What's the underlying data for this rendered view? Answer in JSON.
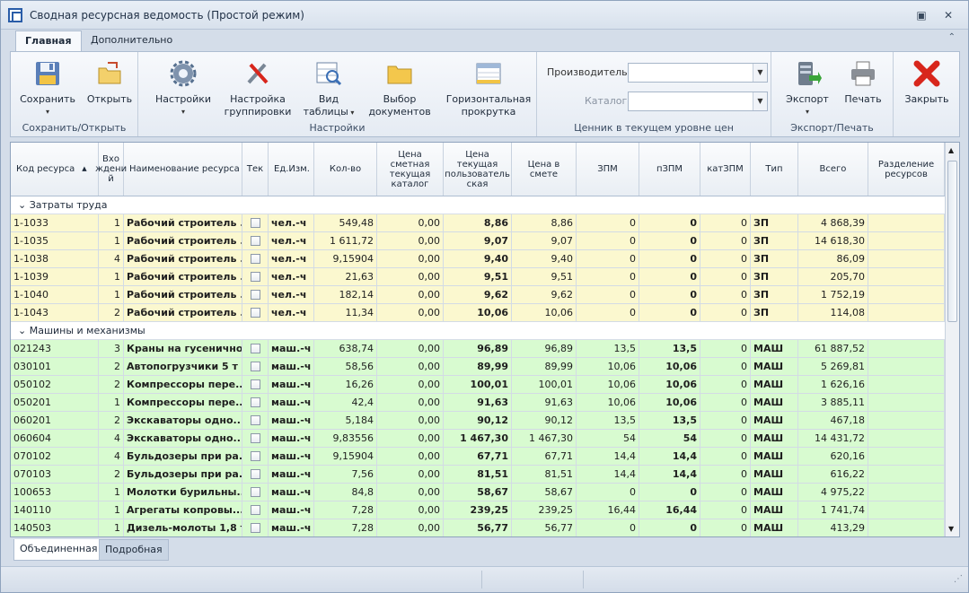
{
  "window": {
    "title": "Сводная ресурсная ведомость (Простой режим)"
  },
  "ribbon_tabs": [
    {
      "label": "Главная"
    },
    {
      "label": "Дополнительно"
    }
  ],
  "ribbon": {
    "save": "Сохранить",
    "open": "Открыть",
    "group_save": "Сохранить/Открыть",
    "settings": "Настройки",
    "grouping": "Настройка группировки",
    "view": "Вид таблицы",
    "docs": "Выбор документов",
    "hscroll": "Горизонтальная прокрутка",
    "group_settings": "Настройки",
    "manufacturer_label": "Производитель",
    "catalog_label": "Каталог",
    "manufacturer_value": "",
    "catalog_value": "",
    "group_price": "Ценник в текущем уровне цен",
    "export": "Экспорт",
    "print": "Печать",
    "group_export": "Экспорт/Печать",
    "close": "Закрыть"
  },
  "grid": {
    "columns": [
      "Код ресурса",
      "Вхождений",
      "Наименование ресурса",
      "Тек",
      "Ед.Изм.",
      "Кол-во",
      "Цена сметная текущая каталог",
      "Цена текущая пользовательская",
      "Цена в смете",
      "ЗПМ",
      "пЗПМ",
      "катЗПМ",
      "Тип",
      "Всего",
      "Разделение ресурсов"
    ],
    "column_display": [
      "Код ресурса",
      "Вхо ждени й",
      "Наименование ресурса",
      "Тек",
      "Ед.Изм.",
      "Кол-во",
      "Цена сметная текущая каталог",
      "Цена текущая пользователь ская",
      "Цена в смете",
      "ЗПМ",
      "пЗПМ",
      "катЗПМ",
      "Тип",
      "Всего",
      "Разделение ресурсов"
    ],
    "groups": [
      {
        "name": "Затраты труда",
        "kind": "zp",
        "rows": [
          {
            "code": "1-1033",
            "cnt": "1",
            "name": "Рабочий строитель ...",
            "unit": "чел.-ч",
            "qty": "549,48",
            "p1": "0,00",
            "p2": "8,86",
            "p3": "8,86",
            "z1": "0",
            "z2": "0",
            "z3": "0",
            "type": "ЗП",
            "total": "4 868,39"
          },
          {
            "code": "1-1035",
            "cnt": "1",
            "name": "Рабочий строитель ...",
            "unit": "чел.-ч",
            "qty": "1 611,72",
            "p1": "0,00",
            "p2": "9,07",
            "p3": "9,07",
            "z1": "0",
            "z2": "0",
            "z3": "0",
            "type": "ЗП",
            "total": "14 618,30"
          },
          {
            "code": "1-1038",
            "cnt": "4",
            "name": "Рабочий строитель ...",
            "unit": "чел.-ч",
            "qty": "9,15904",
            "p1": "0,00",
            "p2": "9,40",
            "p3": "9,40",
            "z1": "0",
            "z2": "0",
            "z3": "0",
            "type": "ЗП",
            "total": "86,09"
          },
          {
            "code": "1-1039",
            "cnt": "1",
            "name": "Рабочий строитель ...",
            "unit": "чел.-ч",
            "qty": "21,63",
            "p1": "0,00",
            "p2": "9,51",
            "p3": "9,51",
            "z1": "0",
            "z2": "0",
            "z3": "0",
            "type": "ЗП",
            "total": "205,70"
          },
          {
            "code": "1-1040",
            "cnt": "1",
            "name": "Рабочий строитель ...",
            "unit": "чел.-ч",
            "qty": "182,14",
            "p1": "0,00",
            "p2": "9,62",
            "p3": "9,62",
            "z1": "0",
            "z2": "0",
            "z3": "0",
            "type": "ЗП",
            "total": "1 752,19"
          },
          {
            "code": "1-1043",
            "cnt": "2",
            "name": "Рабочий строитель ...",
            "unit": "чел.-ч",
            "qty": "11,34",
            "p1": "0,00",
            "p2": "10,06",
            "p3": "10,06",
            "z1": "0",
            "z2": "0",
            "z3": "0",
            "type": "ЗП",
            "total": "114,08"
          }
        ]
      },
      {
        "name": "Машины и механизмы",
        "kind": "mash",
        "rows": [
          {
            "code": "021243",
            "cnt": "3",
            "name": "Краны на гусенично...",
            "unit": "маш.-ч",
            "qty": "638,74",
            "p1": "0,00",
            "p2": "96,89",
            "p3": "96,89",
            "z1": "13,5",
            "z2": "13,5",
            "z3": "0",
            "type": "МАШ",
            "total": "61 887,52"
          },
          {
            "code": "030101",
            "cnt": "2",
            "name": "Автопогрузчики 5 т",
            "unit": "маш.-ч",
            "qty": "58,56",
            "p1": "0,00",
            "p2": "89,99",
            "p3": "89,99",
            "z1": "10,06",
            "z2": "10,06",
            "z3": "0",
            "type": "МАШ",
            "total": "5 269,81"
          },
          {
            "code": "050102",
            "cnt": "2",
            "name": "Компрессоры пере...",
            "unit": "маш.-ч",
            "qty": "16,26",
            "p1": "0,00",
            "p2": "100,01",
            "p3": "100,01",
            "z1": "10,06",
            "z2": "10,06",
            "z3": "0",
            "type": "МАШ",
            "total": "1 626,16"
          },
          {
            "code": "050201",
            "cnt": "1",
            "name": "Компрессоры пере...",
            "unit": "маш.-ч",
            "qty": "42,4",
            "p1": "0,00",
            "p2": "91,63",
            "p3": "91,63",
            "z1": "10,06",
            "z2": "10,06",
            "z3": "0",
            "type": "МАШ",
            "total": "3 885,11"
          },
          {
            "code": "060201",
            "cnt": "2",
            "name": "Экскаваторы одно...",
            "unit": "маш.-ч",
            "qty": "5,184",
            "p1": "0,00",
            "p2": "90,12",
            "p3": "90,12",
            "z1": "13,5",
            "z2": "13,5",
            "z3": "0",
            "type": "МАШ",
            "total": "467,18"
          },
          {
            "code": "060604",
            "cnt": "4",
            "name": "Экскаваторы одно...",
            "unit": "маш.-ч",
            "qty": "9,83556",
            "p1": "0,00",
            "p2": "1 467,30",
            "p3": "1 467,30",
            "z1": "54",
            "z2": "54",
            "z3": "0",
            "type": "МАШ",
            "total": "14 431,72"
          },
          {
            "code": "070102",
            "cnt": "4",
            "name": "Бульдозеры при ра...",
            "unit": "маш.-ч",
            "qty": "9,15904",
            "p1": "0,00",
            "p2": "67,71",
            "p3": "67,71",
            "z1": "14,4",
            "z2": "14,4",
            "z3": "0",
            "type": "МАШ",
            "total": "620,16"
          },
          {
            "code": "070103",
            "cnt": "2",
            "name": "Бульдозеры при ра...",
            "unit": "маш.-ч",
            "qty": "7,56",
            "p1": "0,00",
            "p2": "81,51",
            "p3": "81,51",
            "z1": "14,4",
            "z2": "14,4",
            "z3": "0",
            "type": "МАШ",
            "total": "616,22"
          },
          {
            "code": "100653",
            "cnt": "1",
            "name": "Молотки бурильны...",
            "unit": "маш.-ч",
            "qty": "84,8",
            "p1": "0,00",
            "p2": "58,67",
            "p3": "58,67",
            "z1": "0",
            "z2": "0",
            "z3": "0",
            "type": "МАШ",
            "total": "4 975,22"
          },
          {
            "code": "140110",
            "cnt": "1",
            "name": "Агрегаты копровы...",
            "unit": "маш.-ч",
            "qty": "7,28",
            "p1": "0,00",
            "p2": "239,25",
            "p3": "239,25",
            "z1": "16,44",
            "z2": "16,44",
            "z3": "0",
            "type": "МАШ",
            "total": "1 741,74"
          },
          {
            "code": "140503",
            "cnt": "1",
            "name": "Дизель-молоты 1,8 т",
            "unit": "маш.-ч",
            "qty": "7,28",
            "p1": "0,00",
            "p2": "56,77",
            "p3": "56,77",
            "z1": "0",
            "z2": "0",
            "z3": "0",
            "type": "МАШ",
            "total": "413,29"
          }
        ]
      }
    ]
  },
  "bottom_tabs": [
    {
      "label": "Объединенная"
    },
    {
      "label": "Подробная"
    }
  ],
  "colors": {
    "zp_row": "#fbf8cf",
    "mash_row": "#d8fbd0",
    "accent": "#2a5da8",
    "close_red": "#d8261c"
  }
}
